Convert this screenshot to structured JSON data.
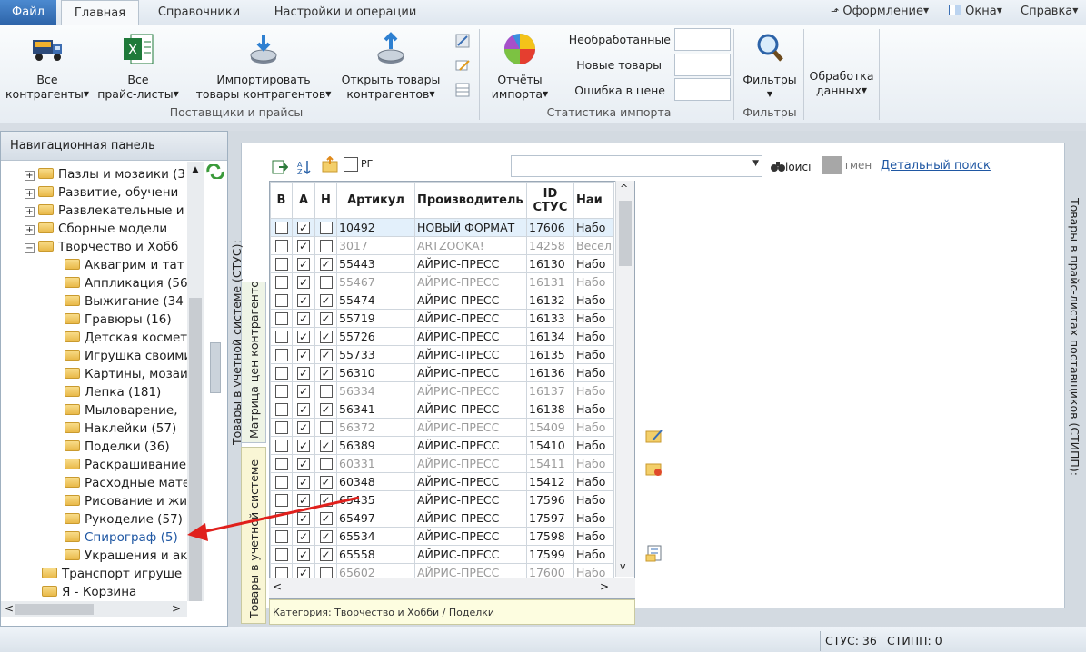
{
  "tabs": {
    "file": "Файл",
    "home": "Главная",
    "refs": "Справочники",
    "settings": "Настройки и операции"
  },
  "top_right": {
    "design": "Оформление",
    "windows": "Окна",
    "help": "Справка"
  },
  "ribbon": {
    "all_contractors": [
      "Все",
      "контрагенты"
    ],
    "all_pricelists": [
      "Все",
      "прайс-листы"
    ],
    "import_goods": [
      "Импортировать",
      "товары контрагентов"
    ],
    "open_goods": [
      "Открыть товары",
      "контрагентов"
    ],
    "group_suppliers": "Поставщики и прайсы",
    "import_reports": [
      "Отчёты",
      "импорта"
    ],
    "stat_unprocessed": "Необработанные",
    "stat_new": "Новые товары",
    "stat_price_error": "Ошибка в цене",
    "group_stats": "Статистика импорта",
    "filters_btn": "Фильтры",
    "group_filters": "Фильтры",
    "processing": [
      "Обработка",
      "данных"
    ]
  },
  "nav": {
    "title": "Навигационная панель",
    "items": [
      {
        "label": "Пазлы и мозаики (3",
        "level": 1,
        "expander": "+"
      },
      {
        "label": "Развитие, обучени",
        "level": 1,
        "expander": "+"
      },
      {
        "label": "Развлекательные и",
        "level": 1,
        "expander": "+"
      },
      {
        "label": "Сборные модели",
        "level": 1,
        "expander": "+"
      },
      {
        "label": "Творчество и Хобб",
        "level": 1,
        "expander": "−"
      },
      {
        "label": "Аквагрим и тат",
        "level": 2
      },
      {
        "label": "Аппликация (56",
        "level": 2
      },
      {
        "label": "Выжигание (34",
        "level": 2
      },
      {
        "label": "Гравюры (16)",
        "level": 2
      },
      {
        "label": "Детская космет",
        "level": 2
      },
      {
        "label": "Игрушка своими",
        "level": 2
      },
      {
        "label": "Картины, мозаи",
        "level": 2
      },
      {
        "label": "Лепка (181)",
        "level": 2
      },
      {
        "label": "Мыловарение, ",
        "level": 2
      },
      {
        "label": "Наклейки (57)",
        "level": 2
      },
      {
        "label": "Поделки (36)",
        "level": 2
      },
      {
        "label": "Раскрашивание",
        "level": 2
      },
      {
        "label": "Расходные мате",
        "level": 2
      },
      {
        "label": "Рисование и жи",
        "level": 2
      },
      {
        "label": "Рукоделие (57)",
        "level": 2
      },
      {
        "label": "Спирограф (5)",
        "level": 2,
        "highlight": true
      },
      {
        "label": "Украшения и ак",
        "level": 2
      },
      {
        "label": "Транспорт игруше",
        "level": 1
      },
      {
        "label": "Я - Корзина",
        "level": 1
      }
    ]
  },
  "side_tabs": {
    "stus": "Товары в учетной системе (СТУС):",
    "matrix": "Матрица цен контрагентов",
    "in_system": "Товары в учетной системе",
    "stipp": "Товары в прайс-листах поставщиков (СТИПП):"
  },
  "toolbar": {
    "pf_label": "РГ",
    "search_label": "loиcı",
    "temen_label": "тмен",
    "detailed_search": "Детальный поиск"
  },
  "grid": {
    "headers": [
      "В",
      "А",
      "Н",
      "Артикул",
      "Производитель",
      "ID СТУС",
      "Наи"
    ],
    "rows": [
      {
        "b": false,
        "a": true,
        "n": false,
        "art": "10492",
        "maker": "НОВЫЙ ФОРМАТ",
        "id": "17606",
        "name": "Набо",
        "dim": false,
        "sel": true
      },
      {
        "b": false,
        "a": true,
        "n": false,
        "art": "3017",
        "maker": "ARTZOOKA!",
        "id": "14258",
        "name": "Весел",
        "dim": true
      },
      {
        "b": false,
        "a": true,
        "n": true,
        "art": "55443",
        "maker": "АЙРИС-ПРЕСС",
        "id": "16130",
        "name": "Набо",
        "dim": false
      },
      {
        "b": false,
        "a": true,
        "n": false,
        "art": "55467",
        "maker": "АЙРИС-ПРЕСС",
        "id": "16131",
        "name": "Набо",
        "dim": true
      },
      {
        "b": false,
        "a": true,
        "n": true,
        "art": "55474",
        "maker": "АЙРИС-ПРЕСС",
        "id": "16132",
        "name": "Набо",
        "dim": false
      },
      {
        "b": false,
        "a": true,
        "n": true,
        "art": "55719",
        "maker": "АЙРИС-ПРЕСС",
        "id": "16133",
        "name": "Набо",
        "dim": false
      },
      {
        "b": false,
        "a": true,
        "n": true,
        "art": "55726",
        "maker": "АЙРИС-ПРЕСС",
        "id": "16134",
        "name": "Набо",
        "dim": false
      },
      {
        "b": false,
        "a": true,
        "n": true,
        "art": "55733",
        "maker": "АЙРИС-ПРЕСС",
        "id": "16135",
        "name": "Набо",
        "dim": false
      },
      {
        "b": false,
        "a": true,
        "n": true,
        "art": "56310",
        "maker": "АЙРИС-ПРЕСС",
        "id": "16136",
        "name": "Набо",
        "dim": false
      },
      {
        "b": false,
        "a": true,
        "n": false,
        "art": "56334",
        "maker": "АЙРИС-ПРЕСС",
        "id": "16137",
        "name": "Набо",
        "dim": true
      },
      {
        "b": false,
        "a": true,
        "n": true,
        "art": "56341",
        "maker": "АЙРИС-ПРЕСС",
        "id": "16138",
        "name": "Набо",
        "dim": false
      },
      {
        "b": false,
        "a": true,
        "n": false,
        "art": "56372",
        "maker": "АЙРИС-ПРЕСС",
        "id": "15409",
        "name": "Набо",
        "dim": true
      },
      {
        "b": false,
        "a": true,
        "n": true,
        "art": "56389",
        "maker": "АЙРИС-ПРЕСС",
        "id": "15410",
        "name": "Набо",
        "dim": false
      },
      {
        "b": false,
        "a": true,
        "n": false,
        "art": "60331",
        "maker": "АЙРИС-ПРЕСС",
        "id": "15411",
        "name": "Набо",
        "dim": true
      },
      {
        "b": false,
        "a": true,
        "n": true,
        "art": "60348",
        "maker": "АЙРИС-ПРЕСС",
        "id": "15412",
        "name": "Набо",
        "dim": false
      },
      {
        "b": false,
        "a": true,
        "n": true,
        "art": "65435",
        "maker": "АЙРИС-ПРЕСС",
        "id": "17596",
        "name": "Набо",
        "dim": false
      },
      {
        "b": false,
        "a": true,
        "n": true,
        "art": "65497",
        "maker": "АЙРИС-ПРЕСС",
        "id": "17597",
        "name": "Набо",
        "dim": false
      },
      {
        "b": false,
        "a": true,
        "n": true,
        "art": "65534",
        "maker": "АЙРИС-ПРЕСС",
        "id": "17598",
        "name": "Набо",
        "dim": false
      },
      {
        "b": false,
        "a": true,
        "n": true,
        "art": "65558",
        "maker": "АЙРИС-ПРЕСС",
        "id": "17599",
        "name": "Набо",
        "dim": false
      },
      {
        "b": false,
        "a": true,
        "n": false,
        "art": "65602",
        "maker": "АЙРИС-ПРЕСС",
        "id": "17600",
        "name": "Набо",
        "dim": true
      }
    ],
    "category": "Категория:  Творчество и Хобби / Поделки"
  },
  "status": {
    "stus": "СТУС: 36",
    "stipp": "СТИПП: 0"
  },
  "colors": {
    "accent": "#2c63a8",
    "link": "#1f57a3",
    "arrow": "#e0201c"
  }
}
